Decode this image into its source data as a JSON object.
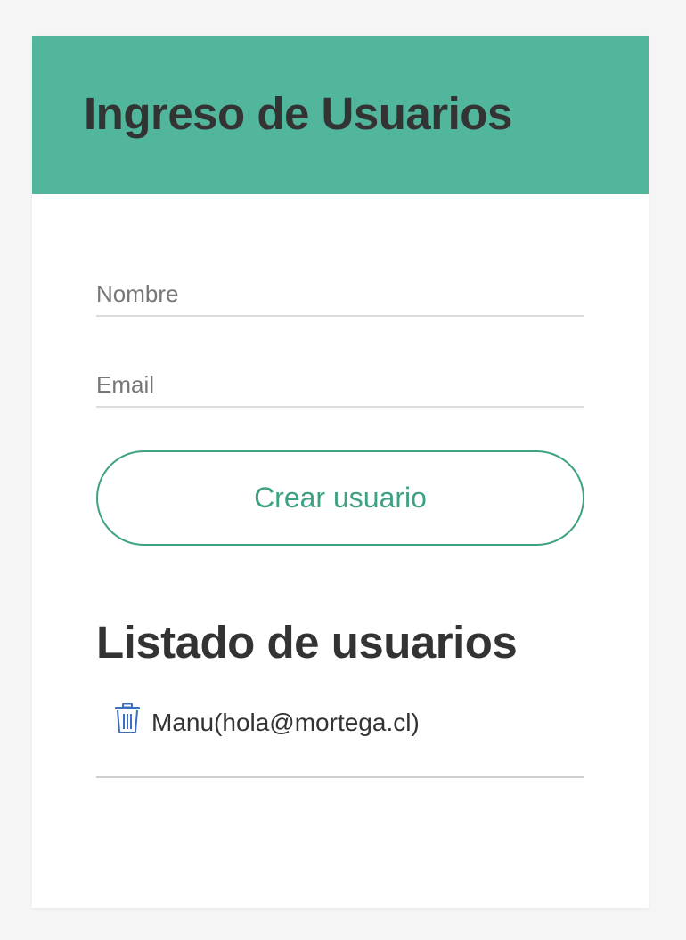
{
  "header": {
    "title": "Ingreso de Usuarios",
    "background_color": "#52b69c"
  },
  "form": {
    "name_placeholder": "Nombre",
    "name_value": "",
    "email_placeholder": "Email",
    "email_value": "",
    "submit_label": "Crear usuario",
    "accent_color": "#3fa183"
  },
  "users": {
    "title": "Listado de usuarios",
    "items": [
      {
        "text": "Manu(hola@mortega.cl)",
        "icon": "trash-icon"
      }
    ]
  }
}
